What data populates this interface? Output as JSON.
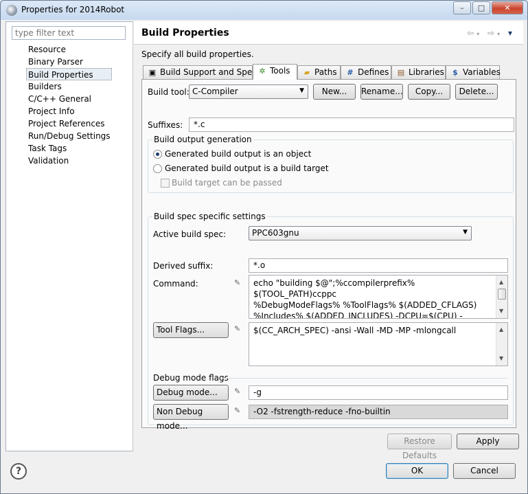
{
  "window": {
    "title": "Properties for 2014Robot",
    "controls": {
      "minimize": "–",
      "maximize": "□",
      "close": "✕"
    }
  },
  "sidebar": {
    "filter_placeholder": "type filter text",
    "items": [
      {
        "label": "Resource"
      },
      {
        "label": "Binary Parser"
      },
      {
        "label": "Build Properties",
        "selected": true
      },
      {
        "label": "Builders"
      },
      {
        "label": "C/C++ General"
      },
      {
        "label": "Project Info"
      },
      {
        "label": "Project References"
      },
      {
        "label": "Run/Debug Settings"
      },
      {
        "label": "Task Tags"
      },
      {
        "label": "Validation"
      }
    ]
  },
  "page": {
    "title": "Build Properties",
    "description": "Specify all build properties.",
    "nav": {
      "back": "⇦",
      "forward": "⇨",
      "menu": "▾"
    }
  },
  "tabs": [
    {
      "label": "Build Support and Specs",
      "icon": "build-support-icon"
    },
    {
      "label": "Tools",
      "icon": "tools-icon",
      "active": true
    },
    {
      "label": "Paths",
      "icon": "folder-icon"
    },
    {
      "label": "Defines",
      "icon": "hash-icon"
    },
    {
      "label": "Libraries",
      "icon": "libraries-icon"
    },
    {
      "label": "Variables",
      "icon": "dollar-icon"
    }
  ],
  "tools": {
    "build_tool_label": "Build tool:",
    "build_tool_value": "C-Compiler",
    "buttons": {
      "new": "New...",
      "rename": "Rename...",
      "copy": "Copy...",
      "delete": "Delete..."
    },
    "suffixes_label": "Suffixes:",
    "suffixes_value": "*.c",
    "build_output": {
      "title": "Build output generation",
      "option_object": "Generated build output is an object",
      "option_target": "Generated build output is a build target",
      "option_passed": "Build target can be passed",
      "selected": "object"
    },
    "spec": {
      "title": "Build spec specific settings",
      "active_label": "Active build spec:",
      "active_value": "PPC603gnu",
      "derived_label": "Derived suffix:",
      "derived_value": "*.o",
      "command_label": "Command:",
      "command_lines": [
        "echo \"building $@\";%ccompilerprefix% $(TOOL_PATH)ccppc",
        "%DebugModeFlags% %ToolFlags% $(ADDED_CFLAGS)",
        "%Includes% $(ADDED_INCLUDES) -DCPU=$(CPU) -"
      ],
      "tool_flags_button": "Tool Flags...",
      "tool_flags_value": "$(CC_ARCH_SPEC) -ansi  -Wall  -MD -MP -mlongcall",
      "debug_title": "Debug mode flags",
      "debug_button": "Debug mode...",
      "debug_value": "-g",
      "nondebug_button": "Non Debug mode...",
      "nondebug_value": "-O2 -fstrength-reduce -fno-builtin"
    }
  },
  "footer": {
    "restore": "Restore Defaults",
    "apply": "Apply",
    "ok": "OK",
    "cancel": "Cancel",
    "help": "?"
  }
}
